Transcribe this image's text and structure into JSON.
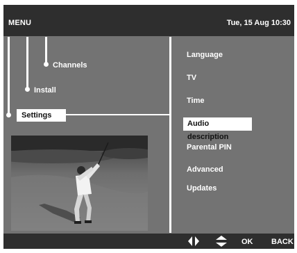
{
  "header": {
    "title": "MENU",
    "datetime": "Tue, 15 Aug 10:30"
  },
  "tree": {
    "level3": "Channels",
    "level2": "Install",
    "level1": "Settings"
  },
  "submenu": {
    "items": [
      {
        "label": "Language",
        "selected": false
      },
      {
        "label": "TV",
        "selected": false
      },
      {
        "label": "Time",
        "selected": false
      },
      {
        "label": "Audio description",
        "selected": true
      },
      {
        "label": "Parental PIN",
        "selected": false
      },
      {
        "label": "Advanced",
        "selected": false
      },
      {
        "label": "Updates",
        "selected": false
      }
    ]
  },
  "preview": {
    "icon": "golfer-video-preview"
  },
  "footer": {
    "left_right_icon": "left-right-arrows-icon",
    "up_down_icon": "up-down-arrows-icon",
    "ok_label": "OK",
    "back_label": "BACK"
  },
  "colors": {
    "panel": "#737373",
    "bars": "#2e2e2e",
    "highlight": "#ffffff"
  }
}
